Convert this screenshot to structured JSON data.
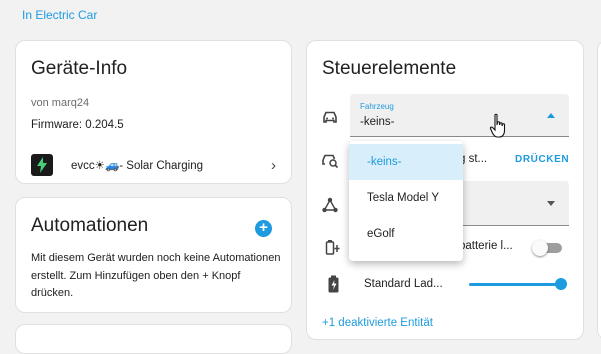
{
  "top_link": "In Electric Car",
  "device_info": {
    "title": "Geräte-Info",
    "manufacturer": "von marq24",
    "firmware": "Firmware: 0.204.5",
    "integration_entry": "evcc☀🚙- Solar Charging"
  },
  "automations": {
    "title": "Automationen",
    "description": "Mit diesem Gerät wurden noch keine Automationen erstellt. Zum Hinzufügen oben den + Knopf drücken."
  },
  "controls": {
    "title": "Steuerelemente",
    "vehicle_select": {
      "label": "Fahrzeug",
      "value": "-keins-"
    },
    "row2_text": "g st...",
    "row2_button": "DRÜCKEN",
    "row4_text": "batterie l...",
    "row4_toggle_on": false,
    "row5_text": "Standard Lad...",
    "row5_slider_level": 1.0,
    "disabled_link": "+1 deaktivierte Entität"
  },
  "dropdown": {
    "options": [
      "-keins-",
      "Tesla Model Y",
      "eGolf"
    ],
    "selected_index": 0
  },
  "colors": {
    "accent": "#1e9be0",
    "background": "#f2f2f2",
    "card": "#ffffff",
    "selected_bg": "#d8eefb"
  }
}
